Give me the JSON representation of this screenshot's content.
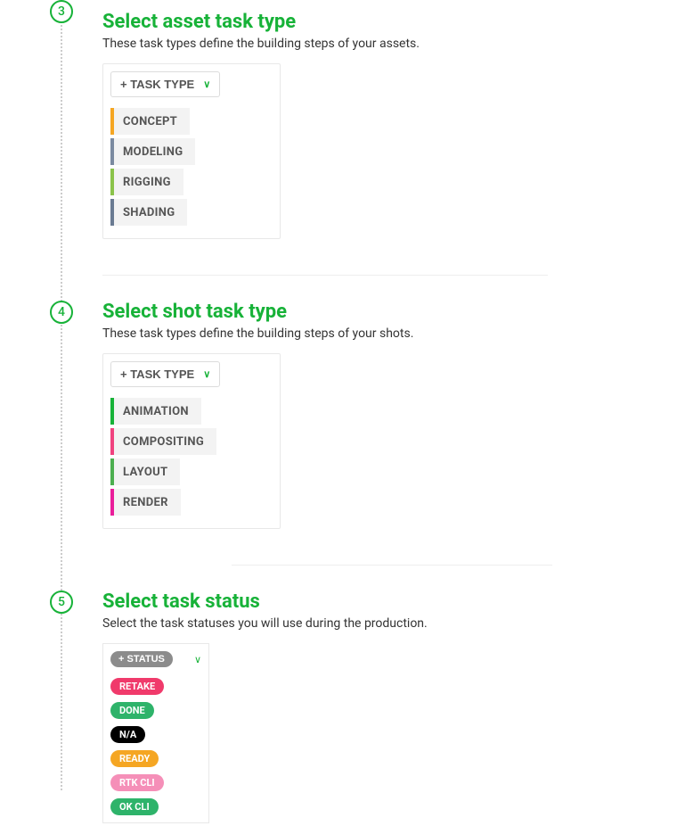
{
  "steps": {
    "s3": {
      "number": "3",
      "title": "Select asset task type",
      "desc": "These task types define the building steps of your assets.",
      "add_label": "+ TASK TYPE",
      "tasks": [
        {
          "label": "CONCEPT",
          "color": "#f5a623"
        },
        {
          "label": "MODELING",
          "color": "#7b8aa0"
        },
        {
          "label": "RIGGING",
          "color": "#8bc34a"
        },
        {
          "label": "SHADING",
          "color": "#6a7b92"
        }
      ]
    },
    "s4": {
      "number": "4",
      "title": "Select shot task type",
      "desc": "These task types define the building steps of your shots.",
      "add_label": "+ TASK TYPE",
      "tasks": [
        {
          "label": "ANIMATION",
          "color": "#17b238"
        },
        {
          "label": "COMPOSITING",
          "color": "#f0437f"
        },
        {
          "label": "LAYOUT",
          "color": "#4caf50"
        },
        {
          "label": "RENDER",
          "color": "#e91e9a"
        }
      ]
    },
    "s5": {
      "number": "5",
      "title": "Select task status",
      "desc": "Select the task statuses you will use during the production.",
      "add_label": "+ STATUS",
      "statuses": [
        {
          "label": "RETAKE",
          "color": "#f03a6b"
        },
        {
          "label": "DONE",
          "color": "#2eb36a"
        },
        {
          "label": "N/A",
          "color": "#000000"
        },
        {
          "label": "READY",
          "color": "#f5a623"
        },
        {
          "label": "RTK CLI",
          "color": "#f58fb8"
        },
        {
          "label": "OK CLI",
          "color": "#2eb36a"
        }
      ]
    }
  }
}
